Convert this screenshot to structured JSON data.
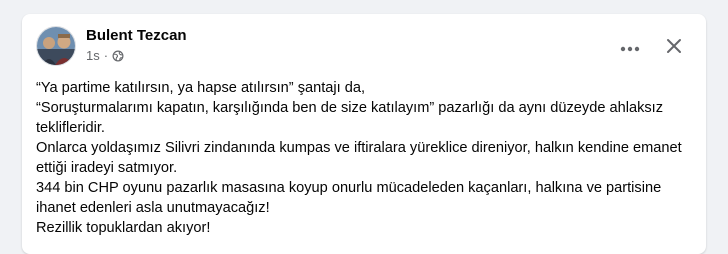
{
  "post": {
    "author": "Bulent Tezcan",
    "timestamp": "1s",
    "separator": "·",
    "audience_icon": "globe-icon",
    "lines": [
      "“Ya partime katılırsın, ya hapse atılırsın” şantajı da,",
      "“Soruşturmalarımı kapatın, karşılığında ben de size katılayım” pazarlığı da aynı düzeyde ahlaksız teklifleridir.",
      "Onlarca yoldaşımız Silivri zindanında kumpas ve iftiralara yüreklice direniyor, halkın kendine emanet ettiği iradeyi satmıyor.",
      "344 bin CHP oyunu pazarlık masasına koyup onurlu mücadeleden kaçanları, halkına ve partisine ihanet edenleri asla unutmayacağız!",
      "Rezillik topuklardan akıyor!"
    ]
  },
  "actions": {
    "more_icon": "more-horizontal-icon",
    "close_icon": "close-icon"
  },
  "colors": {
    "background": "#f0f2f5",
    "card": "#ffffff",
    "text": "#050505",
    "secondary_text": "#65676b"
  }
}
